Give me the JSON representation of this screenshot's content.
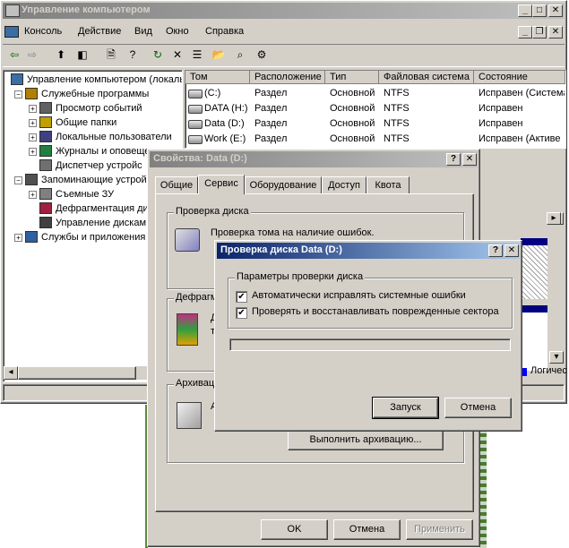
{
  "main_window": {
    "title": "Управление компьютером",
    "menu": [
      "Консоль",
      "Действие",
      "Вид",
      "Окно",
      "Справка"
    ],
    "tree": [
      {
        "label": "Управление компьютером (локаль",
        "level": 0,
        "expander": ""
      },
      {
        "label": "Служебные программы",
        "level": 1,
        "expander": "-"
      },
      {
        "label": "Просмотр событий",
        "level": 2,
        "expander": "+"
      },
      {
        "label": "Общие папки",
        "level": 2,
        "expander": "+"
      },
      {
        "label": "Локальные пользователи",
        "level": 2,
        "expander": "+"
      },
      {
        "label": "Журналы и оповещения",
        "level": 2,
        "expander": "+"
      },
      {
        "label": "Диспетчер устройс",
        "level": 2,
        "expander": ""
      },
      {
        "label": "Запоминающие устройс",
        "level": 1,
        "expander": "-"
      },
      {
        "label": "Съемные ЗУ",
        "level": 2,
        "expander": "+"
      },
      {
        "label": "Дефрагментация ди",
        "level": 2,
        "expander": ""
      },
      {
        "label": "Управление дискам",
        "level": 2,
        "expander": ""
      },
      {
        "label": "Службы и приложения",
        "level": 1,
        "expander": "+"
      }
    ],
    "columns": [
      "Том",
      "Расположение",
      "Тип",
      "Файловая система",
      "Состояние"
    ],
    "rows": [
      [
        "(C:)",
        "Раздел",
        "Основной",
        "NTFS",
        "Исправен (Система"
      ],
      [
        "DATA (H:)",
        "Раздел",
        "Основной",
        "NTFS",
        "Исправен"
      ],
      [
        "Data (D:)",
        "Раздел",
        "Основной",
        "NTFS",
        "Исправен"
      ],
      [
        "Work (E:)",
        "Раздел",
        "Основной",
        "NTFS",
        "Исправен (Активе"
      ]
    ],
    "legend_fragment": "Логичес"
  },
  "properties_dialog": {
    "title": "Свойства: Data (D:)",
    "tabs": [
      "Общие",
      "Сервис",
      "Оборудование",
      "Доступ",
      "Квота"
    ],
    "active_tab": "Сервис",
    "check_group": "Проверка диска",
    "check_text": "Проверка тома на наличие ошибок.",
    "defrag_group": "Дефрагм",
    "defrag_text_1": "Д",
    "defrag_text_2": "т",
    "backup_group": "Архивац",
    "backup_text": "А",
    "backup_button": "Выполнить архивацию...",
    "ok": "OK",
    "cancel": "Отмена",
    "apply": "Применить"
  },
  "check_dialog": {
    "title": "Проверка диска Data (D:)",
    "group": "Параметры проверки диска",
    "option1": "Автоматически исправлять системные ошибки",
    "option1_checked": true,
    "option2": "Проверять и восстанавливать поврежденные сектора",
    "option2_checked": true,
    "progress": 0,
    "start": "Запуск",
    "cancel": "Отмена"
  },
  "colors": {
    "active_title": "#0a246a",
    "inactive_title": "#808080",
    "face": "#d4d0c8"
  }
}
